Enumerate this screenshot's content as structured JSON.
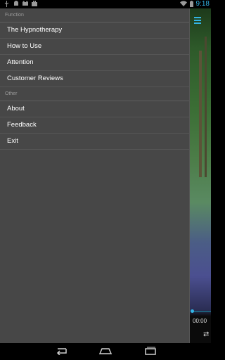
{
  "status_bar": {
    "time": "9:18",
    "icons": [
      "usb-icon",
      "android-debug-icon",
      "cat-icon",
      "briefcase-icon",
      "wifi-icon",
      "battery-icon"
    ]
  },
  "drawer": {
    "sections": [
      {
        "header": "Function",
        "items": [
          "The Hypnotherapy",
          "How to Use",
          "Attention",
          "Customer Reviews"
        ]
      },
      {
        "header": "Other",
        "items": [
          "About",
          "Feedback",
          "Exit"
        ]
      }
    ]
  },
  "background_app": {
    "time_label": "00:00",
    "accent_color": "#33b5e5"
  },
  "nav_bar": {
    "buttons": [
      "back-icon",
      "home-icon",
      "recents-icon"
    ]
  }
}
